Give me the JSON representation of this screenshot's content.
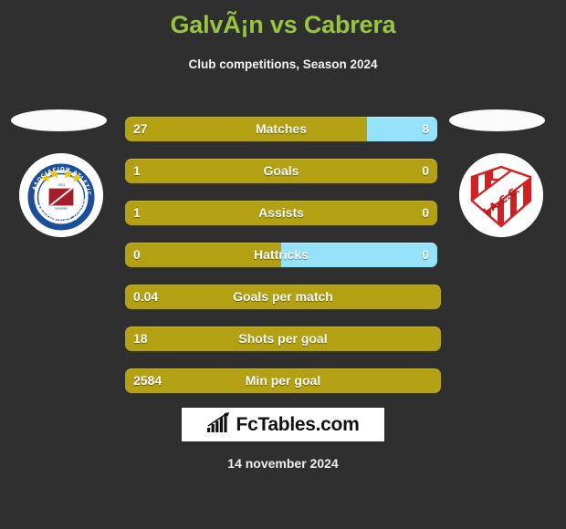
{
  "header": {
    "title": "GalvÃ¡n vs Cabrera",
    "subtitle": "Club competitions, Season 2024"
  },
  "colors": {
    "background": "#2f2f2f",
    "title_green": "#9ac43f",
    "home_gold": "#b3a113",
    "away_blue": "#95e3fb",
    "text_white": "#ffffff"
  },
  "teams": {
    "home": {
      "crest_name": "argentinos-juniors-crest",
      "crest_text": "ASOCIACION ATLETICA ARGENTINOS JUNIORS"
    },
    "away": {
      "crest_name": "instituto-crest",
      "crest_text": "I.A.C.C."
    }
  },
  "stats": [
    {
      "label": "Matches",
      "home": "27",
      "away": "8",
      "home_pct": 77.5,
      "dual": true
    },
    {
      "label": "Goals",
      "home": "1",
      "away": "0",
      "home_pct": 100,
      "dual": true
    },
    {
      "label": "Assists",
      "home": "1",
      "away": "0",
      "home_pct": 100,
      "dual": true
    },
    {
      "label": "Hattricks",
      "home": "0",
      "away": "0",
      "home_pct": 50,
      "dual": true
    },
    {
      "label": "Goals per match",
      "home": "0.04",
      "away": "",
      "home_pct": 100,
      "dual": false
    },
    {
      "label": "Shots per goal",
      "home": "18",
      "away": "",
      "home_pct": 100,
      "dual": false
    },
    {
      "label": "Min per goal",
      "home": "2584",
      "away": "",
      "home_pct": 100,
      "dual": false
    }
  ],
  "footer": {
    "brand": "FcTables.com",
    "logo_icon": "bar-chart-trend-icon",
    "date": "14 november 2024"
  }
}
